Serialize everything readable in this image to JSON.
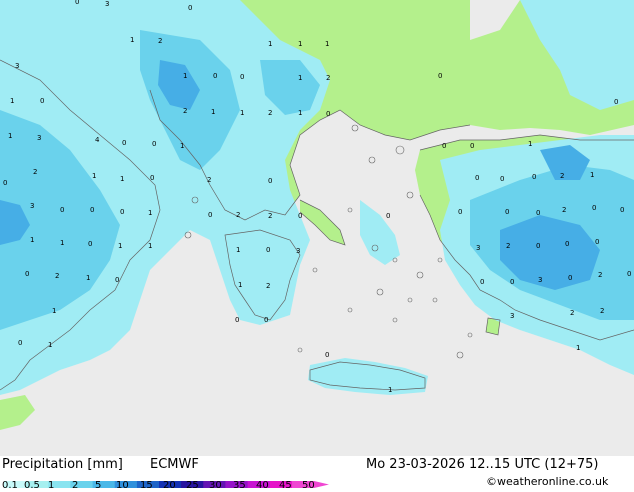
{
  "footer": {
    "title": "Precipitation [mm]",
    "model": "ECMWF",
    "datetime": "Mo 23-03-2026 12..15 UTC (12+75)",
    "credit": "©weatheronline.co.uk"
  },
  "legend": {
    "labels": [
      "0.1",
      "0.5",
      "1",
      "2",
      "5",
      "10",
      "15",
      "20",
      "25",
      "30",
      "35",
      "40",
      "45",
      "50"
    ],
    "colors": [
      "#c8fafa",
      "#a6f0f0",
      "#8ae4f0",
      "#6ad2ec",
      "#4ab8e8",
      "#3090dc",
      "#1e64c8",
      "#1432b4",
      "#2814a0",
      "#6414b4",
      "#9614c8",
      "#c814d2",
      "#e614c8",
      "#f046d2"
    ]
  },
  "colors": {
    "sea": "#ebebeb",
    "land": "#b4f08c",
    "precip_light": "#a0ecf4",
    "precip_medium": "#6ad2ec",
    "precip_heavy": "#46aee6"
  },
  "map_values": [
    {
      "v": "3"
    },
    {
      "v": "1"
    },
    {
      "v": "0"
    },
    {
      "v": "0"
    },
    {
      "v": "1"
    },
    {
      "v": "2"
    },
    {
      "v": "0"
    },
    {
      "v": "1"
    },
    {
      "v": "1"
    },
    {
      "v": "3"
    },
    {
      "v": "1"
    },
    {
      "v": "1"
    },
    {
      "v": "0"
    },
    {
      "v": "0"
    },
    {
      "v": "1"
    },
    {
      "v": "2"
    },
    {
      "v": "0"
    },
    {
      "v": "0"
    },
    {
      "v": "2"
    },
    {
      "v": "1"
    },
    {
      "v": "1"
    },
    {
      "v": "2"
    },
    {
      "v": "1"
    },
    {
      "v": "1"
    },
    {
      "v": "0"
    },
    {
      "v": "0"
    },
    {
      "v": "0"
    },
    {
      "v": "0"
    },
    {
      "v": "1"
    },
    {
      "v": "0"
    },
    {
      "v": "3"
    },
    {
      "v": "2"
    },
    {
      "v": "1"
    },
    {
      "v": "1"
    },
    {
      "v": "0"
    },
    {
      "v": "4"
    },
    {
      "v": "1"
    },
    {
      "v": "0"
    },
    {
      "v": "0"
    },
    {
      "v": "2"
    },
    {
      "v": "2"
    },
    {
      "v": "1"
    },
    {
      "v": "0"
    },
    {
      "v": "0"
    },
    {
      "v": "0"
    },
    {
      "v": "2"
    },
    {
      "v": "0"
    },
    {
      "v": "0"
    },
    {
      "v": "0"
    },
    {
      "v": "0"
    },
    {
      "v": "0"
    },
    {
      "v": "0"
    },
    {
      "v": "0"
    },
    {
      "v": "2"
    },
    {
      "v": "1"
    },
    {
      "v": "0"
    },
    {
      "v": "0"
    },
    {
      "v": "0"
    },
    {
      "v": "3"
    },
    {
      "v": "2"
    },
    {
      "v": "0"
    },
    {
      "v": "3"
    },
    {
      "v": "2"
    },
    {
      "v": "1"
    },
    {
      "v": "0"
    },
    {
      "v": "1"
    },
    {
      "v": "1"
    },
    {
      "v": "1"
    },
    {
      "v": "0"
    },
    {
      "v": "3"
    },
    {
      "v": "1"
    },
    {
      "v": "0"
    },
    {
      "v": "0"
    },
    {
      "v": "0"
    },
    {
      "v": "0"
    },
    {
      "v": "2"
    },
    {
      "v": "1"
    },
    {
      "v": "0"
    },
    {
      "v": "1"
    },
    {
      "v": "2"
    },
    {
      "v": "0"
    },
    {
      "v": "0"
    },
    {
      "v": "0"
    },
    {
      "v": "3"
    },
    {
      "v": "2"
    },
    {
      "v": "0"
    },
    {
      "v": "0"
    },
    {
      "v": "1"
    },
    {
      "v": "0"
    },
    {
      "v": "3"
    },
    {
      "v": "2"
    },
    {
      "v": "2"
    },
    {
      "v": "0"
    },
    {
      "v": "1"
    },
    {
      "v": "1"
    },
    {
      "v": "1"
    },
    {
      "v": "0"
    }
  ]
}
